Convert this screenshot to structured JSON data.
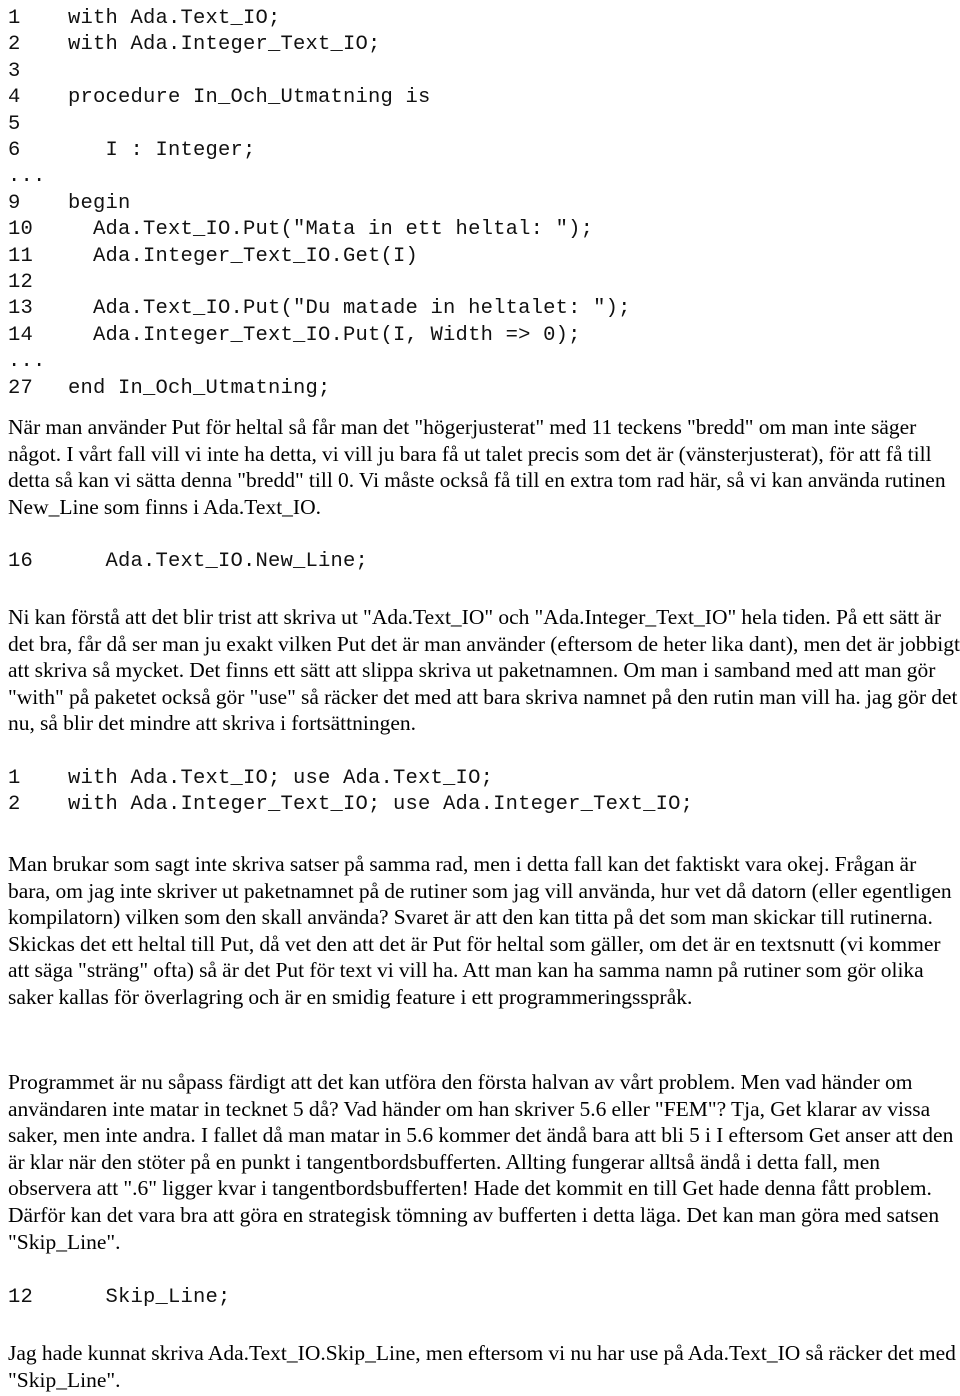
{
  "document": {
    "language": "sv",
    "type": "programming-tutorial-ada"
  },
  "code_block_1": {
    "name": "ada-program-in-och-utmatning",
    "lines": [
      {
        "number": "1",
        "code": "with Ada.Text_IO;"
      },
      {
        "number": "2",
        "code": "with Ada.Integer_Text_IO;"
      },
      {
        "number": "3",
        "code": ""
      },
      {
        "number": "4",
        "code": "procedure In_Och_Utmatning is"
      },
      {
        "number": "5",
        "code": ""
      },
      {
        "number": "6",
        "code": "   I : Integer;"
      },
      {
        "number": "...",
        "code": ""
      },
      {
        "number": "9",
        "code": "begin"
      },
      {
        "number": "10",
        "code": "  Ada.Text_IO.Put(\"Mata in ett heltal: \");"
      },
      {
        "number": "11",
        "code": "  Ada.Integer_Text_IO.Get(I)"
      },
      {
        "number": "12",
        "code": ""
      },
      {
        "number": "13",
        "code": "  Ada.Text_IO.Put(\"Du matade in heltalet: \");"
      },
      {
        "number": "14",
        "code": "  Ada.Integer_Text_IO.Put(I, Width => 0);"
      },
      {
        "number": "...",
        "code": ""
      },
      {
        "number": "27",
        "code": "end In_Och_Utmatning;"
      }
    ]
  },
  "paragraph_1": {
    "text": "När man använder Put för heltal så får man det \"högerjusterat\" med 11 teckens \"bredd\" om man inte säger något. I vårt fall vill vi inte ha detta, vi vill ju bara få ut talet precis som det är (vänsterjusterat), för att få till detta så kan vi sätta denna \"bredd\" till 0.  Vi måste också få till en extra tom rad här, så vi kan använda rutinen New_Line som finns i Ada.Text_IO."
  },
  "code_block_2": {
    "name": "ada-new-line-snippet",
    "lines": [
      {
        "number": "16",
        "code": "   Ada.Text_IO.New_Line;"
      }
    ]
  },
  "paragraph_2": {
    "text": "Ni kan förstå att det blir trist att skriva ut \"Ada.Text_IO\" och \"Ada.Integer_Text_IO\" hela tiden. På ett sätt är det bra, får då ser man ju exakt vilken Put det är man använder (eftersom de heter lika dant), men det är jobbigt att skriva så mycket. Det finns ett sätt att slippa skriva ut paketnamnen. Om man i samband med att man gör \"with\" på paketet också gör \"use\" så räcker det med att bara skriva namnet på den rutin man vill ha. jag gör det nu, så blir det mindre att skriva i fortsättningen."
  },
  "code_block_3": {
    "name": "ada-with-use-snippet",
    "lines": [
      {
        "number": "1",
        "code": "with Ada.Text_IO; use Ada.Text_IO;"
      },
      {
        "number": "2",
        "code": "with Ada.Integer_Text_IO; use Ada.Integer_Text_IO;"
      }
    ]
  },
  "paragraph_3": {
    "text": "Man brukar som sagt inte skriva satser på samma rad, men i detta fall kan det faktiskt vara okej. Frågan är bara, om jag inte skriver ut paketnamnet på de rutiner som jag vill använda, hur vet då datorn (eller egentligen kompilatorn) vilken som den skall använda?  Svaret är att den kan titta på det som man skickar till rutinerna. Skickas det ett heltal till Put, då vet den att det är Put för heltal som gäller, om det är en textsnutt (vi kommer att säga \"sträng\" ofta) så är det Put för text vi vill ha. Att man kan ha samma namn på rutiner som gör olika saker kallas för överlagring och är en smidig feature i ett programmeringsspråk."
  },
  "paragraph_4": {
    "text": "Programmet är nu såpass färdigt att det kan utföra den första halvan av vårt problem. Men vad händer om användaren inte matar in tecknet 5 då? Vad händer om han skriver 5.6 eller \"FEM\"? Tja, Get klarar av vissa saker, men inte andra. I fallet då man matar in 5.6 kommer det ändå bara att bli 5 i I eftersom Get anser att den är klar när den stöter på en punkt i tangentbordsbufferten. Allting fungerar alltså ändå i detta fall, men observera att \".6\" ligger kvar i tangentbordsbufferten!  Hade det kommit en till Get hade denna fått problem. Därför kan det vara bra att göra en strategisk tömning av bufferten i detta läga. Det kan man göra med satsen \"Skip_Line\"."
  },
  "code_block_4": {
    "name": "ada-skip-line-snippet",
    "lines": [
      {
        "number": "12",
        "code": "   Skip_Line;"
      }
    ]
  },
  "paragraph_5": {
    "text": "Jag hade kunnat skriva Ada.Text_IO.Skip_Line, men eftersom vi nu har use på Ada.Text_IO så räcker det med \"Skip_Line\"."
  }
}
